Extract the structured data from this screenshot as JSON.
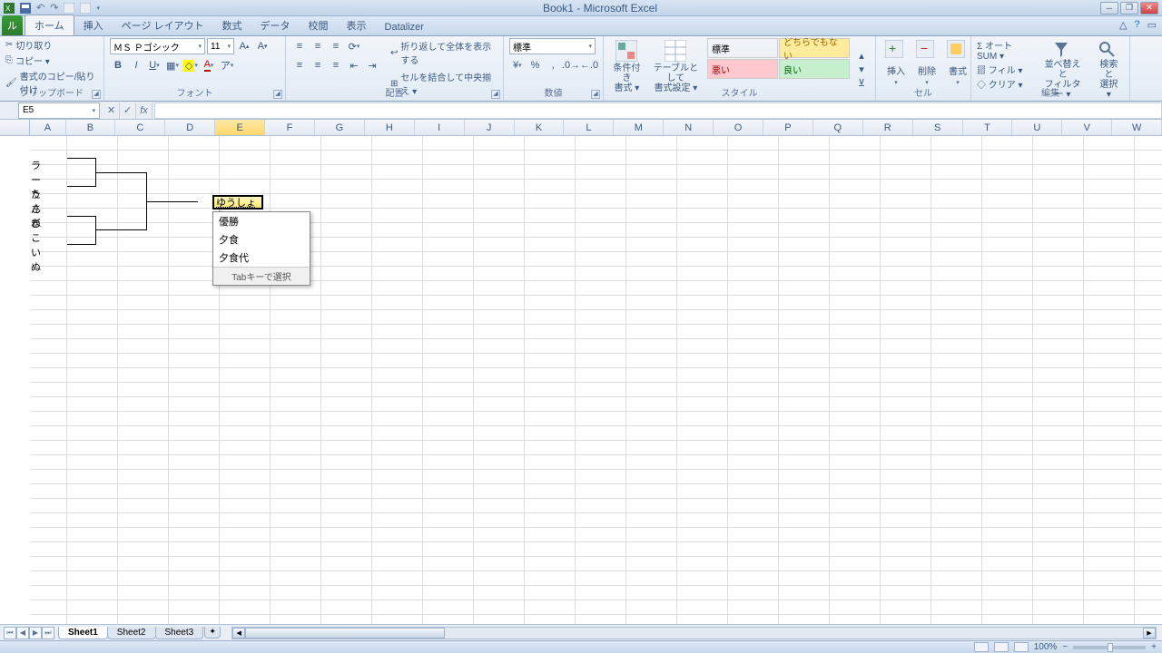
{
  "title": "Book1 - Microsoft Excel",
  "tabs": {
    "file": "ル",
    "home": "ホーム",
    "insert": "挿入",
    "layout": "ページ レイアウト",
    "formulas": "数式",
    "data": "データ",
    "review": "校閲",
    "view": "表示",
    "datalizer": "Datalizer"
  },
  "clipboard": {
    "cut": "切り取り",
    "copy": "コピー ▾",
    "paste_fmt": "書式のコピー/貼り付け",
    "label": "クリップボード"
  },
  "font": {
    "name": "ＭＳ Ｐゴシック",
    "size": "11",
    "label": "フォント"
  },
  "align": {
    "wrap": "折り返して全体を表示する",
    "merge": "セルを結合して中央揃え ▾",
    "label": "配置"
  },
  "number": {
    "fmt": "標準",
    "label": "数値"
  },
  "styles": {
    "cond": "条件付き\n書式 ▾",
    "table": "テーブルとして\n書式設定 ▾",
    "std": "標準",
    "neutral": "どちらでもない",
    "bad": "悪い",
    "good": "良い",
    "label": "スタイル"
  },
  "cells": {
    "insert": "挿入",
    "delete": "削除",
    "format": "書式",
    "label": "セル"
  },
  "edit": {
    "sum": "オート SUM ▾",
    "fill": "フィル ▾",
    "clear": "クリア ▾",
    "sort": "並べ替えと\nフィルター ▾",
    "find": "検索と\n選択 ▾",
    "label": "編集"
  },
  "name_box": "E5",
  "sheet_cells": {
    "a2": "ラーたん",
    "a4": "うさぎ",
    "a6": "ねこ",
    "a8": "いぬ"
  },
  "active_text": "ゆうしょう",
  "ime": {
    "c1": "優勝",
    "c2": "夕食",
    "c3": "夕食代",
    "footer": "Tabキーで選択"
  },
  "sheets": {
    "s1": "Sheet1",
    "s2": "Sheet2",
    "s3": "Sheet3"
  },
  "zoom": "100%",
  "cols": [
    "A",
    "B",
    "C",
    "D",
    "E",
    "F",
    "G",
    "H",
    "I",
    "J",
    "K",
    "L",
    "M",
    "N",
    "O",
    "P",
    "Q",
    "R",
    "S",
    "T",
    "U",
    "V",
    "W"
  ]
}
